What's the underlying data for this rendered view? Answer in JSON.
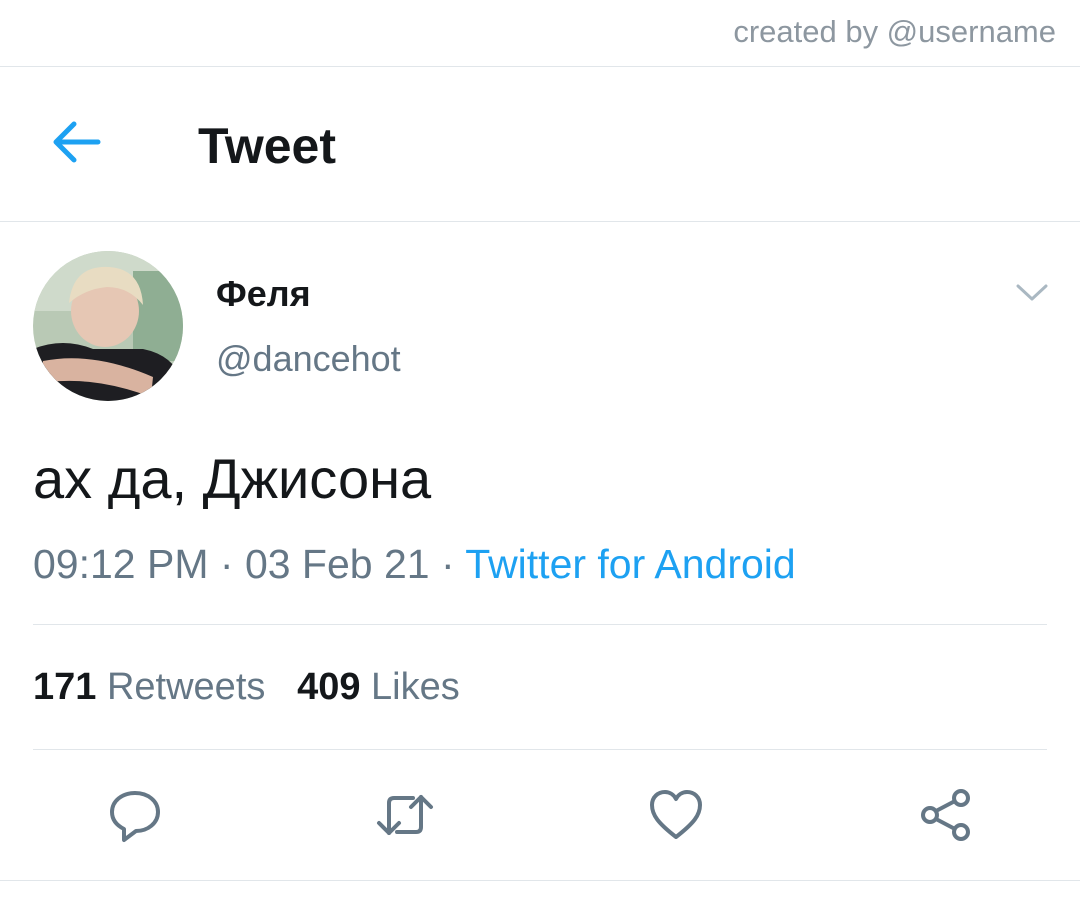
{
  "credit": "created by @username",
  "header": {
    "title": "Tweet",
    "back_icon": "arrow-left-icon"
  },
  "tweet": {
    "author_name": "Феля",
    "author_handle": "@dancehot",
    "text": "ах да, Джисона",
    "time": "09:12 PM",
    "date": "03 Feb 21",
    "source": "Twitter for Android",
    "separator": " · "
  },
  "stats": {
    "retweets_count": "171",
    "retweets_label": "Retweets",
    "likes_count": "409",
    "likes_label": "Likes"
  },
  "actions": [
    "reply-icon",
    "retweet-icon",
    "like-icon",
    "share-icon"
  ],
  "colors": {
    "accent": "#1da1f2",
    "muted": "#657786",
    "text": "#14171a",
    "divider": "#e1e6ea"
  }
}
